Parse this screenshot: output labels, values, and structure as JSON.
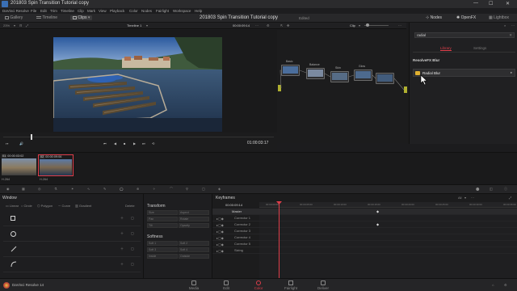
{
  "titlebar": {
    "title": "201803 Spin Transition Tutorial copy",
    "minimize": "—",
    "maximize": "☐",
    "close": "✕"
  },
  "menu": [
    "DaVinci Resolve",
    "File",
    "Edit",
    "Trim",
    "Timeline",
    "Clip",
    "Mark",
    "View",
    "Playback",
    "Color",
    "Nodes",
    "Fairlight",
    "Workspace",
    "Help"
  ],
  "topbar": {
    "gallery": "Gallery",
    "timeline": "Timeline",
    "clips": "Clips",
    "project_name": "201803 Spin Transition Tutorial copy",
    "edited": "Edited",
    "nodes": "Nodes",
    "openfx": "OpenFX",
    "lightbox": "Lightbox"
  },
  "viewer": {
    "zoom": "23%",
    "timeline_name": "Timeline 1",
    "timecode": "00:00:09:14",
    "timecode_display": "01:00:03:17",
    "playhead_pct": 10
  },
  "nodes_panel": {
    "mode": "Clip",
    "nodes": [
      "Basic",
      "Balance",
      "Skin",
      "Glow",
      ""
    ]
  },
  "fx_panel": {
    "search_value": "radial",
    "category": "ResolveFX Blur",
    "tab_library": "Library",
    "tab_settings": "Settings",
    "effect": "Radial Blur"
  },
  "clips": [
    {
      "number": "01",
      "timecode": "00:00:03:02",
      "codec": "H.264"
    },
    {
      "number": "02",
      "timecode": "00:00:09:06",
      "codec": "H.264"
    }
  ],
  "window_panel": {
    "title": "Window",
    "tools": [
      "Linear",
      "Circle",
      "Polygon",
      "Curve",
      "Gradient"
    ],
    "delete": "Delete"
  },
  "transform_panel": {
    "transform_title": "Transform",
    "fields": [
      "Size",
      "Aspect",
      "Pan",
      "Rotate",
      "Tilt",
      "Opacity"
    ],
    "softness_title": "Softness",
    "softness_fields": [
      "Soft 1",
      "Soft 2",
      "Soft 3",
      "Soft 4",
      "Inside",
      "Outside"
    ]
  },
  "keyframes_panel": {
    "title": "Keyframes",
    "filter": "All",
    "timecode": "00:00:09:14",
    "ruler": [
      "00:00:00:00",
      "00:00:05:00",
      "00:00:10:00",
      "00:00:15:00",
      "00:00:20:00",
      "00:00:25:00",
      "00:00:30:00",
      "00:00:35:00"
    ],
    "rows": [
      "Master",
      "Corrector 1",
      "Corrector 2",
      "Corrector 3",
      "Corrector 4",
      "Corrector 5",
      "Sizing"
    ]
  },
  "bottomnav": {
    "app": "DaVinci Resolve 14",
    "items": [
      "Media",
      "Edit",
      "Color",
      "Fairlight",
      "Deliver"
    ],
    "active": "Color"
  },
  "colors": {
    "accent": "#e03e4a",
    "bg": "#1c1c1e",
    "library_active": "#e03e4a",
    "highlight": "#e0b030"
  }
}
